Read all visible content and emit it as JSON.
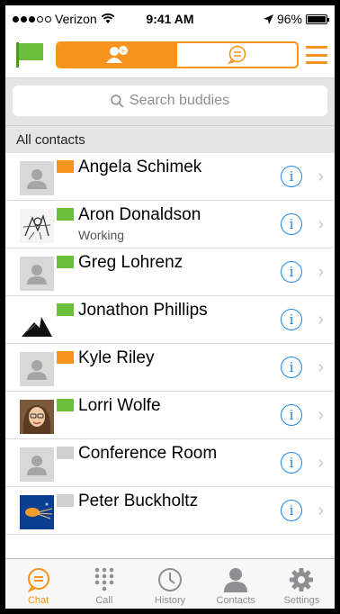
{
  "status_bar": {
    "carrier": "Verizon",
    "time": "9:41 AM",
    "battery": "96%"
  },
  "search": {
    "placeholder": "Search buddies"
  },
  "section_title": "All contacts",
  "contacts": [
    {
      "name": "Angela Schimek",
      "status": "",
      "flag": "orange",
      "avatar": "placeholder"
    },
    {
      "name": "Aron Donaldson",
      "status": "Working",
      "flag": "green",
      "avatar": "sketch"
    },
    {
      "name": "Greg Lohrenz",
      "status": "",
      "flag": "green",
      "avatar": "placeholder"
    },
    {
      "name": "Jonathon Phillips",
      "status": "",
      "flag": "green",
      "avatar": "mountain"
    },
    {
      "name": "Kyle Riley",
      "status": "",
      "flag": "orange",
      "avatar": "placeholder"
    },
    {
      "name": "Lorri Wolfe",
      "status": "",
      "flag": "green",
      "avatar": "photo"
    },
    {
      "name": "Conference Room",
      "status": "",
      "flag": "gray",
      "avatar": "placeholder"
    },
    {
      "name": "Peter Buckholtz",
      "status": "",
      "flag": "gray",
      "avatar": "jellyfish"
    }
  ],
  "tabs": [
    {
      "label": "Chat",
      "icon": "chat-icon",
      "active": true
    },
    {
      "label": "Call",
      "icon": "keypad-icon",
      "active": false
    },
    {
      "label": "History",
      "icon": "clock-icon",
      "active": false
    },
    {
      "label": "Contacts",
      "icon": "person-icon",
      "active": false
    },
    {
      "label": "Settings",
      "icon": "gear-icon",
      "active": false
    }
  ],
  "colors": {
    "accent": "#f7941d",
    "green_flag": "#6cbf3a",
    "orange_flag": "#f7941d",
    "gray_flag": "#cfcfcf",
    "info_blue": "#1a86e8"
  }
}
